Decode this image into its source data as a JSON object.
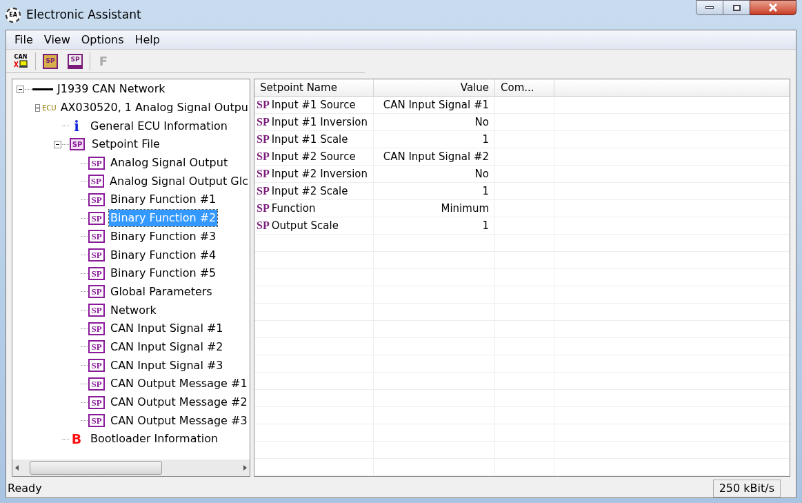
{
  "window": {
    "title": "Electronic Assistant",
    "logo": "EA"
  },
  "menu": [
    "File",
    "View",
    "Options",
    "Help"
  ],
  "toolbar": [
    {
      "kind": "can",
      "label": "CAN",
      "disabled": false
    },
    {
      "kind": "open",
      "label": "SP",
      "disabled": false
    },
    {
      "kind": "save",
      "label": "SP",
      "disabled": false
    },
    {
      "kind": "letter",
      "label": "F",
      "disabled": true
    }
  ],
  "tree": [
    {
      "kind": "network",
      "label": "J1939 CAN Network",
      "expanded": true,
      "selected": false,
      "children": [
        {
          "kind": "ecu",
          "badge": "ECU",
          "label": "AX030520, 1 Analog Signal Outpu",
          "expanded": true,
          "selected": false,
          "children": [
            {
              "kind": "info",
              "badge": "i",
              "label": "General ECU Information",
              "selected": false
            },
            {
              "kind": "folder",
              "badge": "SP",
              "label": "Setpoint File",
              "expanded": true,
              "selected": false,
              "children": [
                {
                  "kind": "sp",
                  "badge": "SP",
                  "label": "Analog Signal Output",
                  "selected": false
                },
                {
                  "kind": "sp",
                  "badge": "SP",
                  "label": "Analog Signal Output Glc",
                  "selected": false
                },
                {
                  "kind": "sp",
                  "badge": "SP",
                  "label": "Binary Function #1",
                  "selected": false
                },
                {
                  "kind": "sp",
                  "badge": "SP",
                  "label": "Binary Function #2",
                  "selected": true
                },
                {
                  "kind": "sp",
                  "badge": "SP",
                  "label": "Binary Function #3",
                  "selected": false
                },
                {
                  "kind": "sp",
                  "badge": "SP",
                  "label": "Binary Function #4",
                  "selected": false
                },
                {
                  "kind": "sp",
                  "badge": "SP",
                  "label": "Binary Function #5",
                  "selected": false
                },
                {
                  "kind": "sp",
                  "badge": "SP",
                  "label": "Global Parameters",
                  "selected": false
                },
                {
                  "kind": "sp",
                  "badge": "SP",
                  "label": "Network",
                  "selected": false
                },
                {
                  "kind": "sp",
                  "badge": "SP",
                  "label": "CAN Input Signal #1",
                  "selected": false
                },
                {
                  "kind": "sp",
                  "badge": "SP",
                  "label": "CAN Input Signal #2",
                  "selected": false
                },
                {
                  "kind": "sp",
                  "badge": "SP",
                  "label": "CAN Input Signal #3",
                  "selected": false
                },
                {
                  "kind": "sp",
                  "badge": "SP",
                  "label": "CAN Output Message #1",
                  "selected": false
                },
                {
                  "kind": "sp",
                  "badge": "SP",
                  "label": "CAN Output Message #2",
                  "selected": false
                },
                {
                  "kind": "sp",
                  "badge": "SP",
                  "label": "CAN Output Message #3",
                  "selected": false
                }
              ]
            },
            {
              "kind": "boot",
              "badge": "B",
              "label": "Bootloader Information",
              "selected": false
            }
          ]
        }
      ]
    }
  ],
  "table": {
    "columns": [
      "Setpoint Name",
      "Value",
      "Com..."
    ],
    "rows": [
      {
        "badge": "SP",
        "name": "Input #1 Source",
        "value": "CAN Input Signal #1"
      },
      {
        "badge": "SP",
        "name": "Input #1 Inversion",
        "value": "No"
      },
      {
        "badge": "SP",
        "name": "Input #1 Scale",
        "value": "1"
      },
      {
        "badge": "SP",
        "name": "Input #2 Source",
        "value": "CAN Input Signal #2"
      },
      {
        "badge": "SP",
        "name": "Input #2 Inversion",
        "value": "No"
      },
      {
        "badge": "SP",
        "name": "Input #2 Scale",
        "value": "1"
      },
      {
        "badge": "SP",
        "name": "Function",
        "value": "Minimum"
      },
      {
        "badge": "SP",
        "name": "Output Scale",
        "value": "1"
      }
    ]
  },
  "status_bar": {
    "message": "Ready",
    "bitrate": "250 kBit/s"
  }
}
